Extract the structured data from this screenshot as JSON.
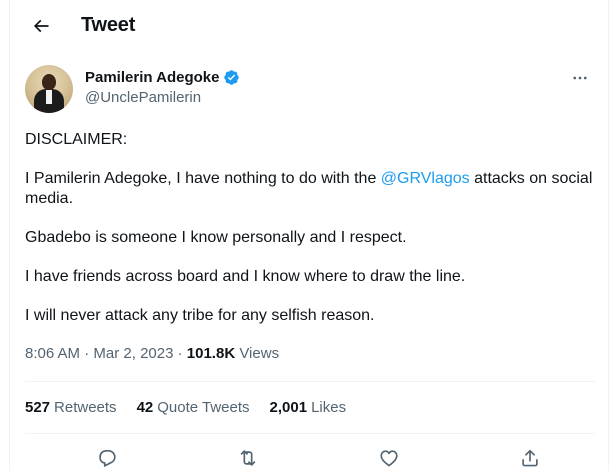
{
  "header": {
    "title": "Tweet",
    "back_icon": "arrow-left-icon"
  },
  "author": {
    "name": "Pamilerin Adegoke",
    "handle": "@UnclePamilerin",
    "verified": true,
    "verified_color": "#1d9bf0"
  },
  "tweet": {
    "paragraphs": {
      "p1": "DISCLAIMER:",
      "p2_before": "I Pamilerin Adegoke, I have nothing to do with the ",
      "p2_mention": "@GRVlagos",
      "p2_after": " attacks on social media.",
      "p3": "Gbadebo is someone I know personally and I respect.",
      "p4": "I have friends across board and I know where to draw the line.",
      "p5": "I will never attack any tribe for any selfish reason."
    },
    "mention_color": "#1d9bf0"
  },
  "meta": {
    "time": "8:06 AM",
    "separator": "·",
    "date": "Mar 2, 2023",
    "views_count": "101.8K",
    "views_label": "Views"
  },
  "stats": {
    "retweets_count": "527",
    "retweets_label": "Retweets",
    "quotes_count": "42",
    "quotes_label": "Quote Tweets",
    "likes_count": "2,001",
    "likes_label": "Likes"
  },
  "actions": {
    "reply_icon": "reply-icon",
    "retweet_icon": "retweet-icon",
    "like_icon": "heart-icon",
    "share_icon": "share-icon"
  }
}
